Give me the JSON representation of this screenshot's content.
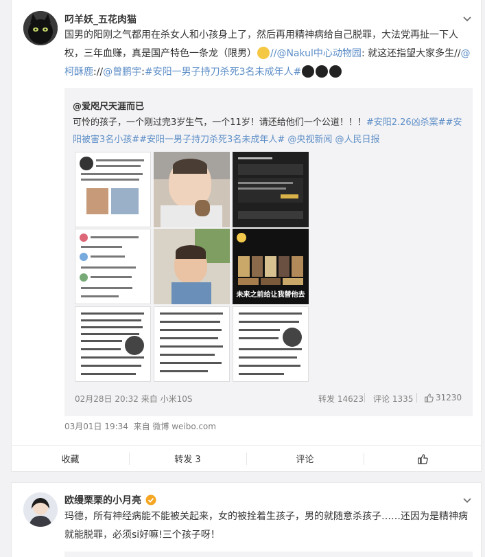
{
  "post1": {
    "username": "叼羊妖_五花肉猫",
    "text": {
      "p1": "国男的阳刚之气都用在杀女人和小孩身上了，然后再用精神病给自己脱罪，大法党再扯一下人权，三年血赚，真是国产特色一条龙（限男）",
      "p2": "//",
      "mention1": "@Nakul中心动物园",
      "p3": ": 就这还指望大家多生//",
      "mention2": "@柯酥鹿",
      "p4": "://",
      "mention3": "@曾鹏宇",
      "p5": ":",
      "hashtag1": "#安阳一男子持刀杀死3名未成年人#"
    },
    "repost": {
      "username": "@爱咫尺天涯而已",
      "text": "可怜的孩子，一个刚过完3岁生气，一个11岁！请还给他们一个公道！！！",
      "hashtags": "#安阳2.26凶杀案##安阳被害3名小孩##安阳一男子持刀杀死3名未成年人#",
      "mention1": "@央视新闻",
      "mention2": "@人民日报",
      "image_caption": "未来之前给让我替他去",
      "time": "02月28日 20:32",
      "source": "来自 小米10S",
      "repost_label": "转发",
      "repost_count": "14623",
      "comment_label": "评论",
      "comment_count": "1335",
      "like_count": "31230"
    },
    "time": "03月01日 19:34",
    "source_prefix": "来自",
    "source": "微博 weibo.com",
    "actions": {
      "favorite": "收藏",
      "repost": "转发 3",
      "comment": "评论"
    }
  },
  "post2": {
    "username": "欧缦栗栗的小月亮",
    "text": "玛德，所有神经病能不能被关起来，女的被拴着生孩子，男的就随意杀孩子……还因为是精神病就能脱罪，必须si好嘛!三个孩子呀！"
  },
  "icons": {
    "chevron": "chevron-down-icon",
    "like": "thumbs-up-icon",
    "verified": "verified-badge-icon"
  },
  "colors": {
    "link": "#eb7350",
    "mention": "#5d8ec7",
    "background": "#f2f2f5",
    "repost_bg": "#f3f3f5"
  }
}
